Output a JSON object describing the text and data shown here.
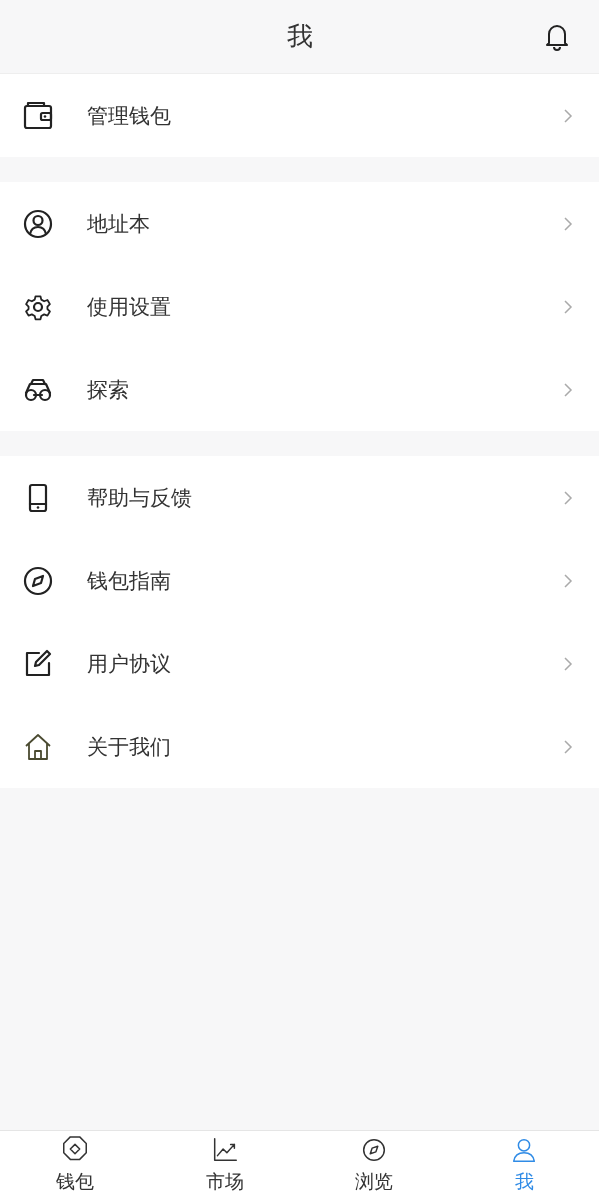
{
  "header": {
    "title": "我"
  },
  "groups": [
    {
      "items": [
        {
          "kind": "wallet",
          "label": "管理钱包"
        }
      ]
    },
    {
      "items": [
        {
          "kind": "contact",
          "label": "地址本"
        },
        {
          "kind": "settings",
          "label": "使用设置"
        },
        {
          "kind": "explore",
          "label": "探索"
        }
      ]
    },
    {
      "items": [
        {
          "kind": "phone",
          "label": "帮助与反馈"
        },
        {
          "kind": "compass",
          "label": "钱包指南"
        },
        {
          "kind": "edit",
          "label": "用户协议"
        },
        {
          "kind": "home",
          "label": "关于我们"
        }
      ]
    }
  ],
  "tab_bar": [
    {
      "kind": "wallet",
      "label": "钱包",
      "selected": false
    },
    {
      "kind": "market",
      "label": "市场",
      "selected": false
    },
    {
      "kind": "browse",
      "label": "浏览",
      "selected": false
    },
    {
      "kind": "me",
      "label": "我",
      "selected": true
    }
  ]
}
